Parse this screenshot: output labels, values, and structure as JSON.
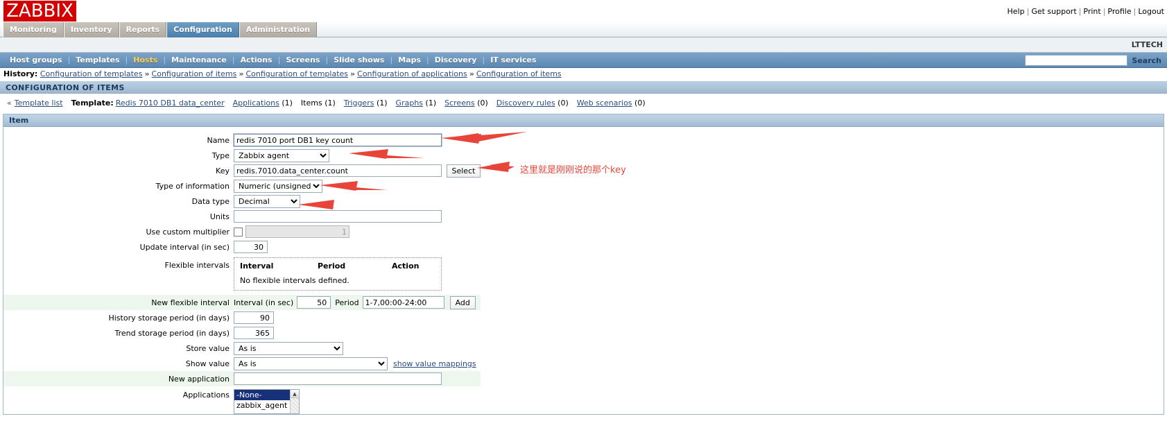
{
  "brand": {
    "logo_text": "ZABBIX"
  },
  "topbar": {
    "links": [
      "Help",
      "Get support",
      "Print",
      "Profile",
      "Logout"
    ],
    "separator": "|"
  },
  "mainmenu": {
    "items": [
      {
        "label": "Monitoring",
        "selected": false
      },
      {
        "label": "Inventory",
        "selected": false
      },
      {
        "label": "Reports",
        "selected": false
      },
      {
        "label": "Configuration",
        "selected": true
      },
      {
        "label": "Administration",
        "selected": false
      }
    ]
  },
  "userbar": {
    "username": "LTTECH"
  },
  "submenu": {
    "items": [
      {
        "label": "Host groups",
        "active": false
      },
      {
        "label": "Templates",
        "active": false
      },
      {
        "label": "Hosts",
        "active": true
      },
      {
        "label": "Maintenance",
        "active": false
      },
      {
        "label": "Actions",
        "active": false
      },
      {
        "label": "Screens",
        "active": false
      },
      {
        "label": "Slide shows",
        "active": false
      },
      {
        "label": "Maps",
        "active": false
      },
      {
        "label": "Discovery",
        "active": false
      },
      {
        "label": "IT services",
        "active": false
      }
    ],
    "separator": "|"
  },
  "search": {
    "value": "",
    "placeholder": "",
    "button_label": "Search"
  },
  "history": {
    "label": "History:",
    "separator": "»",
    "crumbs": [
      "Configuration of templates",
      "Configuration of items",
      "Configuration of templates",
      "Configuration of applications",
      "Configuration of items"
    ]
  },
  "page_title": "CONFIGURATION OF ITEMS",
  "template_nav": {
    "chevron": "«",
    "template_list_link": "Template list",
    "template_label": "Template:",
    "template_name": "Redis 7010 DB1 data_center",
    "tabs": [
      {
        "label": "Applications",
        "count": "(1)",
        "current": false
      },
      {
        "label": "Items",
        "count": "(1)",
        "current": true
      },
      {
        "label": "Triggers",
        "count": "(1)",
        "current": false
      },
      {
        "label": "Graphs",
        "count": "(1)",
        "current": false
      },
      {
        "label": "Screens",
        "count": "(0)",
        "current": false
      },
      {
        "label": "Discovery rules",
        "count": "(0)",
        "current": false
      },
      {
        "label": "Web scenarios",
        "count": "(0)",
        "current": false
      }
    ]
  },
  "panel": {
    "header": "Item"
  },
  "form": {
    "name": {
      "label": "Name",
      "value": "redis 7010 port DB1 key count"
    },
    "type": {
      "label": "Type",
      "value": "Zabbix agent"
    },
    "key": {
      "label": "Key",
      "value": "redis.7010.data_center.count",
      "select_button": "Select"
    },
    "type_of_information": {
      "label": "Type of information",
      "value": "Numeric (unsigned)"
    },
    "data_type": {
      "label": "Data type",
      "value": "Decimal"
    },
    "units": {
      "label": "Units",
      "value": ""
    },
    "custom_multiplier": {
      "label": "Use custom multiplier",
      "checked": false,
      "value": "1"
    },
    "update_interval": {
      "label": "Update interval (in sec)",
      "value": "30"
    },
    "flexible_intervals": {
      "label": "Flexible intervals",
      "columns": [
        "Interval",
        "Period",
        "Action"
      ],
      "empty_text": "No flexible intervals defined."
    },
    "new_flexible_interval": {
      "label": "New flexible interval",
      "interval_label": "Interval (in sec)",
      "interval_value": "50",
      "period_label": "Period",
      "period_value": "1-7,00:00-24:00",
      "add_button": "Add"
    },
    "history_storage": {
      "label": "History storage period (in days)",
      "value": "90"
    },
    "trend_storage": {
      "label": "Trend storage period (in days)",
      "value": "365"
    },
    "store_value": {
      "label": "Store value",
      "value": "As is"
    },
    "show_value": {
      "label": "Show value",
      "value": "As is",
      "mapping_link": "show value mappings"
    },
    "new_application": {
      "label": "New application",
      "value": ""
    },
    "applications": {
      "label": "Applications",
      "options": [
        {
          "label": "-None-",
          "selected": true
        },
        {
          "label": "zabbix_agent",
          "selected": false
        }
      ]
    }
  },
  "annotations": {
    "note_text": "这里就是刚刚说的那个key",
    "arrow_color": "#e8443a"
  }
}
